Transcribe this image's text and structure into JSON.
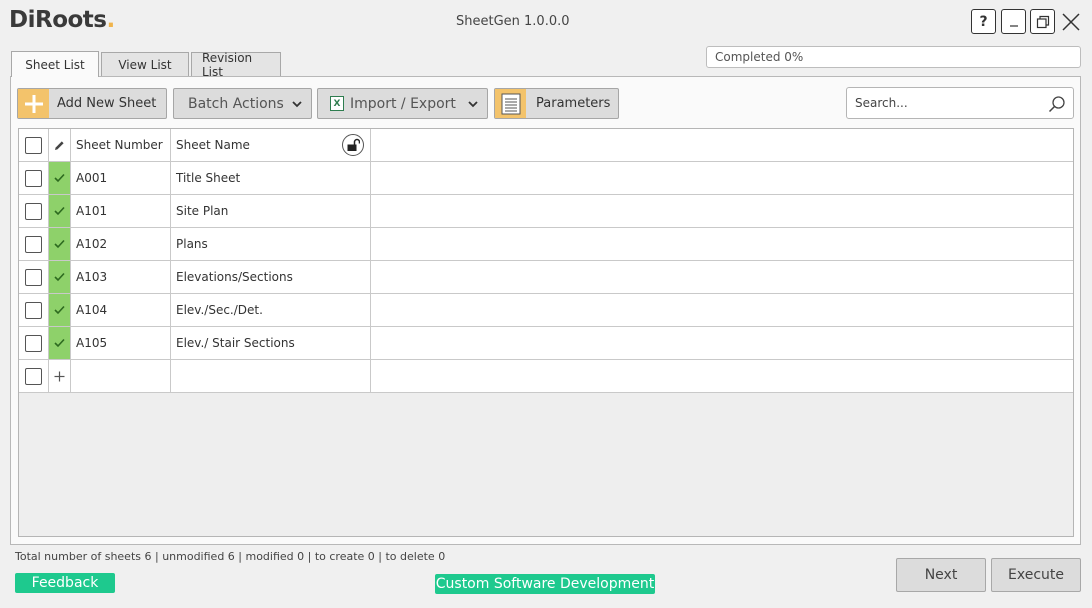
{
  "app": {
    "logo": "DiRoots.",
    "title": "SheetGen 1.0.0.0",
    "help_label": "?"
  },
  "tabs": [
    {
      "label": "Sheet List",
      "active": true
    },
    {
      "label": "View List",
      "active": false
    },
    {
      "label": "Revision List",
      "active": false
    }
  ],
  "progress": {
    "text": "Completed 0%",
    "value": 0
  },
  "toolbar": {
    "add_new_sheet": "Add New Sheet",
    "batch_actions": "Batch Actions",
    "import_export": "Import / Export",
    "parameters": "Parameters",
    "accent_color": "#f3c36b"
  },
  "search": {
    "placeholder": "Search..."
  },
  "grid": {
    "columns": [
      "Sheet Number",
      "Sheet Name"
    ],
    "rows": [
      {
        "number": "A001",
        "name": "Title Sheet"
      },
      {
        "number": "A101",
        "name": "Site Plan"
      },
      {
        "number": "A102",
        "name": "Plans"
      },
      {
        "number": "A103",
        "name": "Elevations/Sections"
      },
      {
        "number": "A104",
        "name": "Elev./Sec./Det."
      },
      {
        "number": "A105",
        "name": "Elev./ Stair Sections"
      }
    ],
    "status_ok_color": "#8ed16a"
  },
  "footer": {
    "summary": "Total number of sheets 6 | unmodified 6 | modified 0 | to create 0 | to delete 0",
    "feedback": "Feedback",
    "custom_dev": "Custom Software Development",
    "next": "Next",
    "execute": "Execute",
    "pill_color": "#1ec98e"
  }
}
